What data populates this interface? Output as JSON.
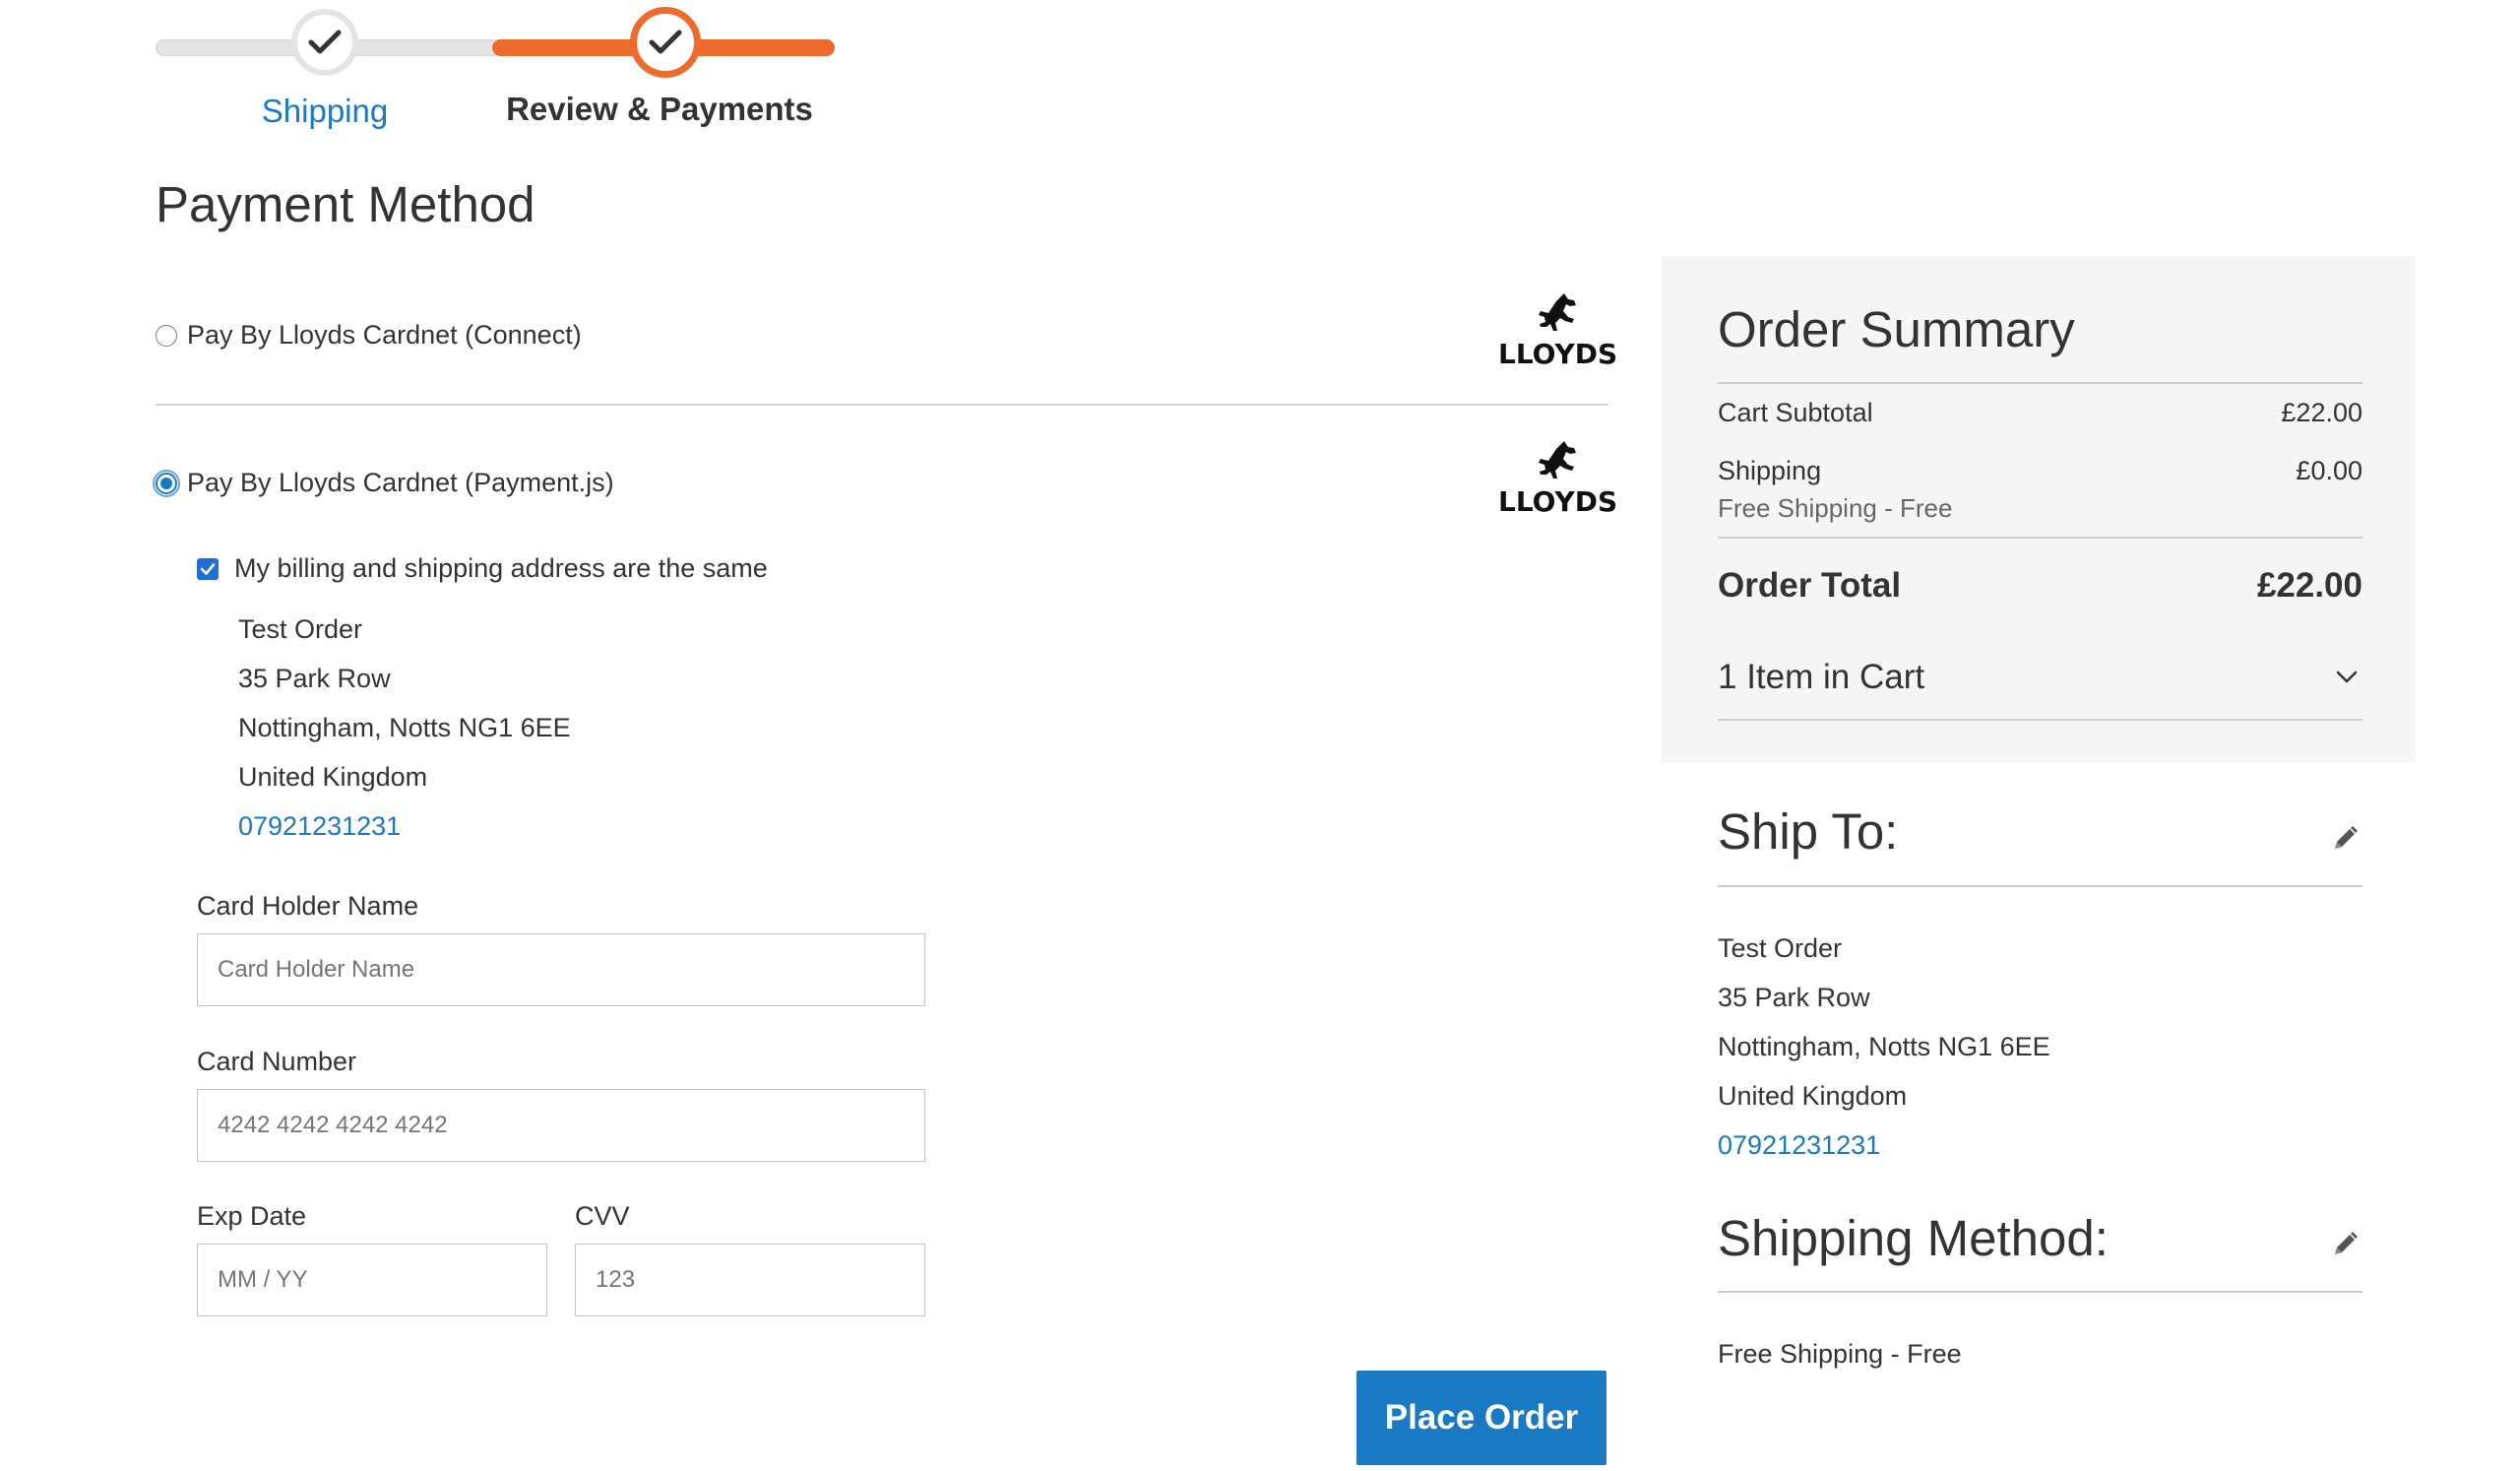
{
  "progress": {
    "steps": [
      {
        "label": "Shipping",
        "state": "complete"
      },
      {
        "label": "Review & Payments",
        "state": "current"
      }
    ],
    "accent_color": "#ec6b2d"
  },
  "payment": {
    "title": "Payment Method",
    "methods": [
      {
        "label": "Pay By Lloyds Cardnet (Connect)",
        "selected": false,
        "logo_text": "LLOYDS"
      },
      {
        "label": "Pay By Lloyds Cardnet (Payment.js)",
        "selected": true,
        "logo_text": "LLOYDS"
      }
    ],
    "same_address_label": "My billing and shipping address are the same",
    "billing_address": {
      "name": "Test Order",
      "street": "35 Park Row",
      "city_line": "Nottingham, Notts NG1 6EE",
      "country": "United Kingdom",
      "phone": "07921231231"
    },
    "fields": {
      "card_holder": {
        "label": "Card Holder Name",
        "placeholder": "Card Holder Name"
      },
      "card_number": {
        "label": "Card Number",
        "placeholder": "4242 4242 4242 4242"
      },
      "exp_date": {
        "label": "Exp Date",
        "placeholder": "MM / YY"
      },
      "cvv": {
        "label": "CVV",
        "placeholder": "123"
      }
    },
    "place_order_label": "Place Order"
  },
  "summary": {
    "title": "Order Summary",
    "cart_subtotal_label": "Cart Subtotal",
    "cart_subtotal_value": "£22.00",
    "shipping_label": "Shipping",
    "shipping_value": "£0.00",
    "shipping_method_sub": "Free Shipping - Free",
    "order_total_label": "Order Total",
    "order_total_value": "£22.00",
    "items_in_cart": "1 Item in Cart"
  },
  "ship_to": {
    "title": "Ship To:",
    "name": "Test Order",
    "street": "35 Park Row",
    "city_line": "Nottingham, Notts NG1 6EE",
    "country": "United Kingdom",
    "phone": "07921231231"
  },
  "shipping_method": {
    "title": "Shipping Method:",
    "value": "Free Shipping - Free"
  }
}
